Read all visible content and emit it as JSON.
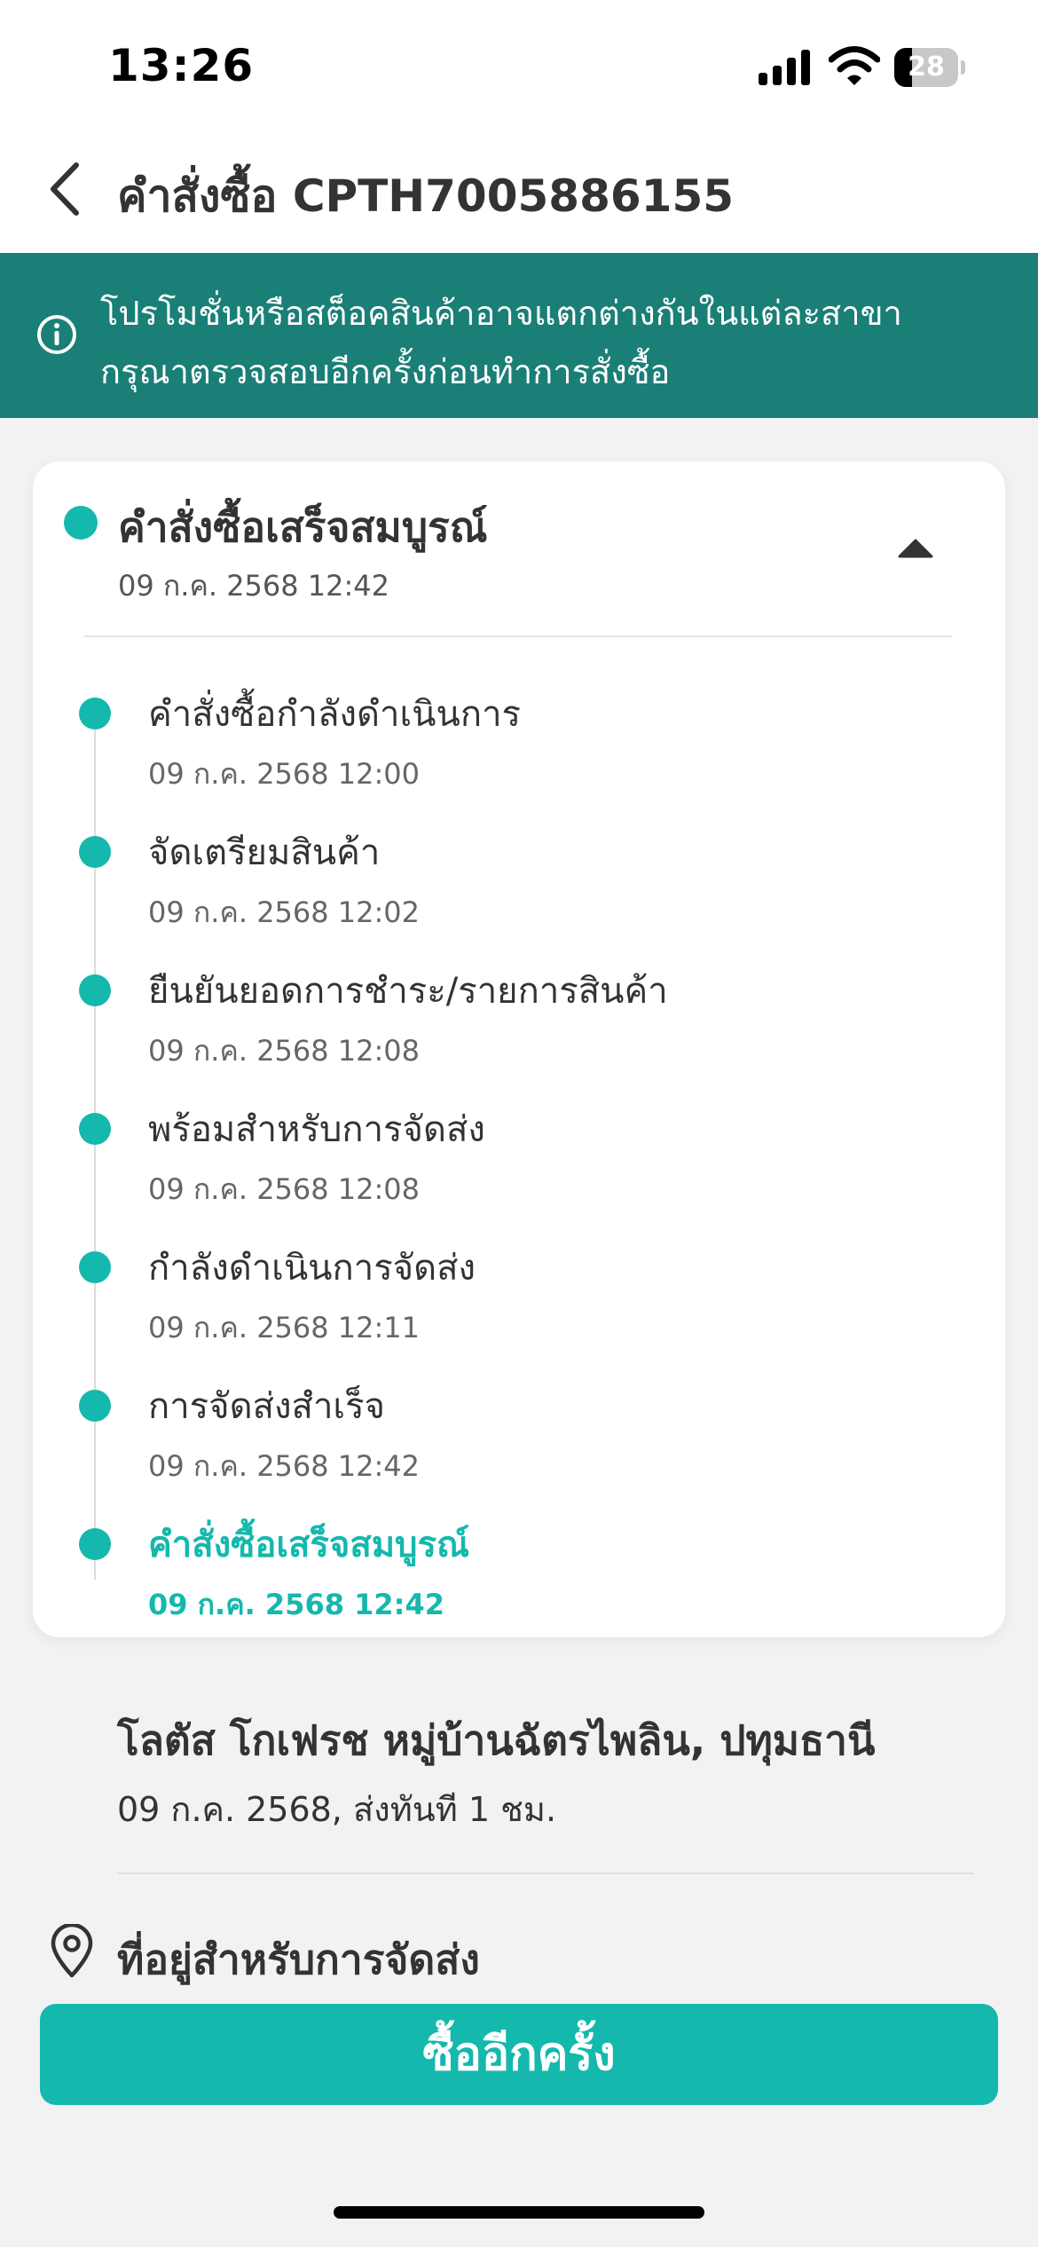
{
  "status_bar": {
    "time": "13:26",
    "battery_level": "28",
    "icons": [
      "signal-icon",
      "wifi-icon",
      "battery-icon"
    ]
  },
  "header": {
    "back_icon": "chevron-left-icon",
    "title": "คำสั่งซื้อ CPTH7005886155"
  },
  "banner": {
    "icon": "info-icon",
    "line1": "โปรโมชั่นหรือสต็อคสินค้าอาจแตกต่างกันในแต่ละสาขา",
    "line2": "กรุณาตรวจสอบอีกครั้งก่อนทำการสั่งซื้อ",
    "background_color": "#1a7f76"
  },
  "order_status": {
    "current_title": "คำสั่งซื้อเสร็จสมบูรณ์",
    "current_date": "09 ก.ค. 2568 12:42",
    "toggle_icon": "chevron-up-icon",
    "accent_color": "#14b8ad",
    "steps": [
      {
        "title": "คำสั่งซื้อกำลังดำเนินการ",
        "date": "09 ก.ค. 2568 12:00"
      },
      {
        "title": "จัดเตรียมสินค้า",
        "date": "09 ก.ค. 2568 12:02"
      },
      {
        "title": "ยืนยันยอดการชำระ/รายการสินค้า",
        "date": "09 ก.ค. 2568 12:08"
      },
      {
        "title": "พร้อมสำหรับการจัดส่ง",
        "date": "09 ก.ค. 2568 12:08"
      },
      {
        "title": "กำลังดำเนินการจัดส่ง",
        "date": "09 ก.ค. 2568 12:11"
      },
      {
        "title": "การจัดส่งสำเร็จ",
        "date": "09 ก.ค. 2568 12:42"
      },
      {
        "title": "คำสั่งซื้อเสร็จสมบูรณ์",
        "date": "09 ก.ค. 2568 12:42"
      }
    ]
  },
  "store": {
    "name": "โลตัส โกเฟรช หมู่บ้านฉัตรไพลิน, ปทุมธานี",
    "meta": "09 ก.ค. 2568, ส่งทันที 1 ชม."
  },
  "delivery_address": {
    "icon": "map-pin-icon",
    "title": "ที่อยู่สำหรับการจัดส่ง"
  },
  "actions": {
    "buy_again_label": "ซื้ออีกครั้ง",
    "button_color": "#14b8ad"
  }
}
